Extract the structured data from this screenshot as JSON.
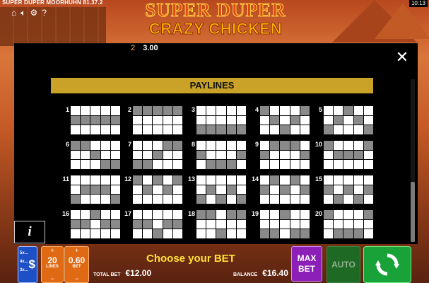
{
  "status_bar": {
    "app_title": "SUPER DUPER MOORHUHN 81.37.2",
    "clock": "10:13"
  },
  "logo": {
    "line1": "SUPER DUPER",
    "line2": "CRAZY CHICKEN"
  },
  "panel": {
    "prev_row": {
      "number": "2",
      "value": "3.00"
    },
    "close_icon": "✕",
    "banner": "PAYLINES",
    "info_label": "i"
  },
  "paylines": [
    {
      "n": "1",
      "rows": [
        1,
        1,
        1,
        1,
        1
      ]
    },
    {
      "n": "2",
      "rows": [
        0,
        0,
        0,
        0,
        0
      ]
    },
    {
      "n": "3",
      "rows": [
        2,
        2,
        2,
        2,
        2
      ]
    },
    {
      "n": "4",
      "rows": [
        0,
        1,
        2,
        1,
        0
      ]
    },
    {
      "n": "5",
      "rows": [
        2,
        1,
        0,
        1,
        2
      ]
    },
    {
      "n": "6",
      "rows": [
        0,
        0,
        1,
        2,
        2
      ]
    },
    {
      "n": "7",
      "rows": [
        2,
        2,
        1,
        0,
        0
      ]
    },
    {
      "n": "8",
      "rows": [
        1,
        2,
        2,
        2,
        1
      ]
    },
    {
      "n": "9",
      "rows": [
        1,
        0,
        0,
        0,
        1
      ]
    },
    {
      "n": "10",
      "rows": [
        0,
        1,
        1,
        1,
        0
      ]
    },
    {
      "n": "11",
      "rows": [
        2,
        1,
        1,
        1,
        2
      ]
    },
    {
      "n": "12",
      "rows": [
        0,
        1,
        0,
        1,
        0
      ]
    },
    {
      "n": "13",
      "rows": [
        2,
        1,
        2,
        1,
        2
      ]
    },
    {
      "n": "14",
      "rows": [
        1,
        0,
        1,
        0,
        1
      ]
    },
    {
      "n": "15",
      "rows": [
        1,
        2,
        1,
        2,
        1
      ]
    },
    {
      "n": "16",
      "rows": [
        1,
        1,
        0,
        1,
        1
      ]
    },
    {
      "n": "17",
      "rows": [
        1,
        1,
        2,
        1,
        1
      ]
    },
    {
      "n": "18",
      "rows": [
        0,
        0,
        2,
        0,
        0
      ]
    },
    {
      "n": "19",
      "rows": [
        2,
        2,
        0,
        2,
        2
      ]
    },
    {
      "n": "20",
      "rows": [
        0,
        2,
        2,
        2,
        0
      ]
    }
  ],
  "controls": {
    "multipliers": [
      "5x...",
      "4x...",
      "3x..."
    ],
    "currency_icon": "$",
    "lines_value": "20",
    "lines_label": "LINES",
    "bet_value": "0.60",
    "bet_label": "BET",
    "plus": "+",
    "minus": "−",
    "prompt": "Choose your BET",
    "total_bet_label": "TOTAL BET",
    "total_bet_value": "€12.00",
    "balance_label": "BALANCE",
    "balance_value": "€16.40",
    "max_bet_line1": "MAX",
    "max_bet_line2": "BET",
    "auto_label": "AUTO",
    "spin_icon": "spin-arrows-icon"
  },
  "colors": {
    "banner": "#c9a227",
    "prompt": "#ffe233",
    "max_bet": "#8b1fb8",
    "auto": "#1e6a24",
    "spin": "#18a238",
    "lines_bet": "#e06a14",
    "multiplier": "#1e4fc4"
  }
}
